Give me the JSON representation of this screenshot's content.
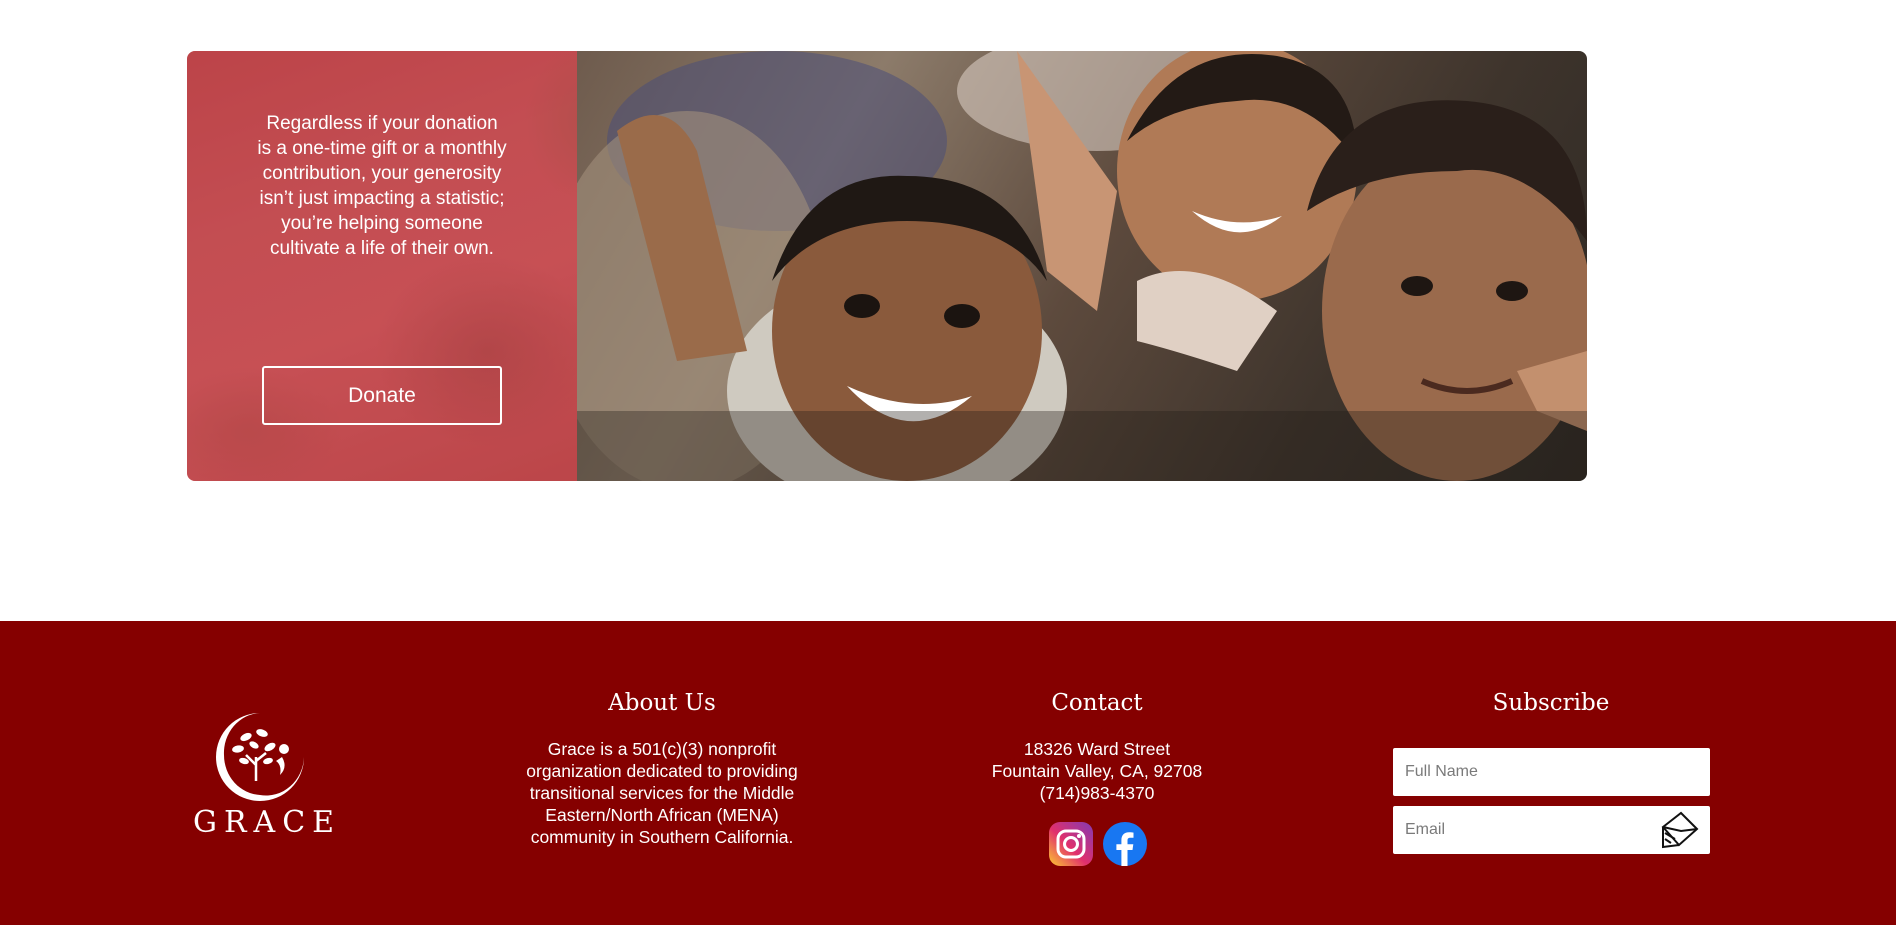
{
  "hero": {
    "message": "Regardless if your donation is a one-time gift or a monthly contribution, your generosity isn’t just impacting a statistic; you’re helping someone cultivate a life of their own.",
    "donate_label": "Donate"
  },
  "footer": {
    "background": "#850000",
    "logo": {
      "wordmark": "GRACE",
      "icon": "tree-circle-logo-icon"
    },
    "about": {
      "title": "About Us",
      "text": "Grace is a 501(c)(3) nonprofit organization dedicated to providing transitional services for the Middle Eastern/North African (MENA) community in Southern California."
    },
    "contact": {
      "title": "Contact",
      "street": "18326 Ward Street",
      "city": "Fountain Valley, CA, 92708",
      "phone": "(714)983-4370",
      "social": [
        "instagram-icon",
        "facebook-icon"
      ]
    },
    "subscribe": {
      "title": "Subscribe",
      "name_placeholder": "Full Name",
      "email_placeholder": "Email",
      "submit_icon": "envelope-send-icon"
    }
  }
}
